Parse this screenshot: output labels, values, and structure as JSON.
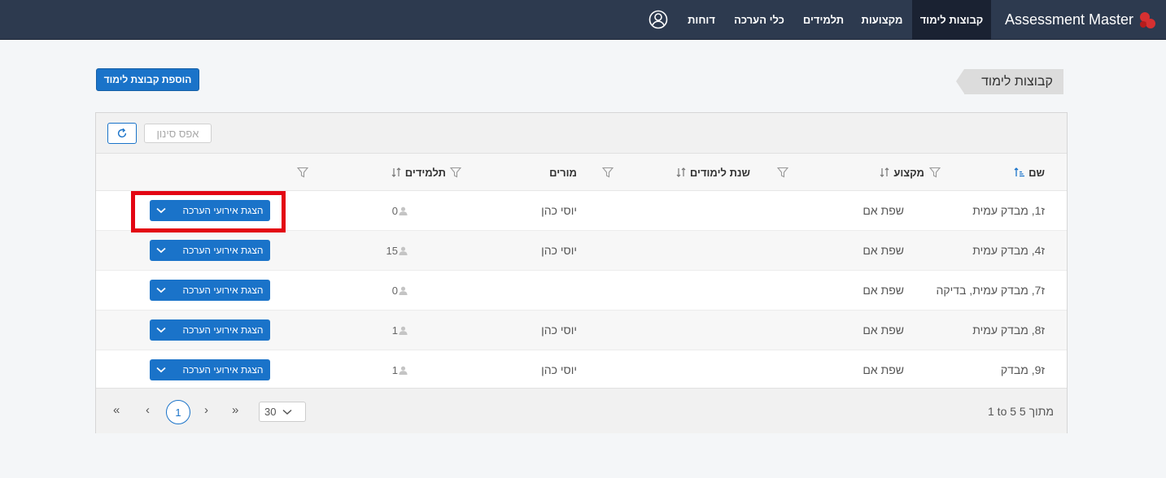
{
  "app": {
    "brand": "Assessment Master"
  },
  "nav": {
    "items": [
      {
        "label": "קבוצות לימוד",
        "active": true
      },
      {
        "label": "מקצועות",
        "active": false
      },
      {
        "label": "תלמידים",
        "active": false
      },
      {
        "label": "כלי הערכה",
        "active": false
      },
      {
        "label": "דוחות",
        "active": false
      }
    ],
    "user_icon": "user-circle-icon"
  },
  "page": {
    "breadcrumb": "קבוצות לימוד",
    "add_button": "הוספת קבוצת לימוד"
  },
  "toolbar": {
    "reset_filter": "אפס סינון",
    "refresh_icon": "refresh-icon"
  },
  "columns": {
    "name": "שם",
    "subject": "מקצוע",
    "school_year": "שנת לימודים",
    "teachers": "מורים",
    "students": "תלמידים"
  },
  "rows": [
    {
      "name": "ז1, מבדק עמית",
      "subject": "שפת אם",
      "school_year": "",
      "teachers": "יוסי כהן",
      "students": "0",
      "action": "הצגת אירועי הערכה"
    },
    {
      "name": "ז4, מבדק עמית",
      "subject": "שפת אם",
      "school_year": "",
      "teachers": "יוסי כהן",
      "students": "15",
      "action": "הצגת אירועי הערכה"
    },
    {
      "name": "ז7, מבדק עמית, בדיקה",
      "subject": "שפת אם",
      "school_year": "",
      "teachers": "",
      "students": "0",
      "action": "הצגת אירועי הערכה"
    },
    {
      "name": "ז8, מבדק עמית",
      "subject": "שפת אם",
      "school_year": "",
      "teachers": "יוסי כהן",
      "students": "1",
      "action": "הצגת אירועי הערכה"
    },
    {
      "name": "ז9, מבדק",
      "subject": "שפת אם",
      "school_year": "",
      "teachers": "יוסי כהן",
      "students": "1",
      "action": "הצגת אירועי הערכה"
    }
  ],
  "pagination": {
    "first": "«",
    "prev": "‹",
    "current_page": "1",
    "next": "›",
    "last": "»",
    "page_size": "30",
    "range_text": "1 to 5 5 מתוך"
  },
  "colors": {
    "accent": "#1a73c9",
    "navbar": "#2d3a4f",
    "highlight": "#e30613"
  }
}
